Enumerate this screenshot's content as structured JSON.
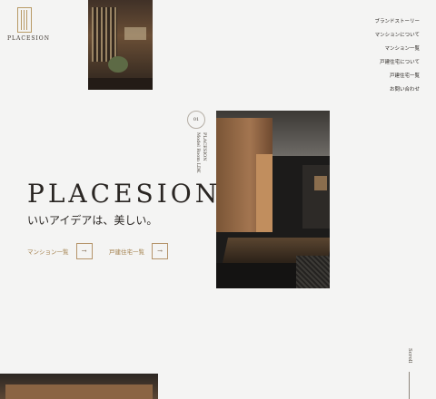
{
  "brand": {
    "logo_text": "PLACESION"
  },
  "nav": {
    "items": [
      "ブランドストーリー",
      "マンションについて",
      "マンション一覧",
      "戸建住宅について",
      "戸建住宅一覧",
      "お問い合わせ"
    ]
  },
  "hero": {
    "title": "PLACESION",
    "subtitle": "いいアイデアは、美しい。",
    "slide_number": "01",
    "caption_line1": "PLACESION",
    "caption_line2": "Model Room LDK"
  },
  "cta": {
    "mansion_label": "マンション一覧",
    "house_label": "戸建住宅一覧",
    "arrow_symbol": "→"
  },
  "scroll": {
    "label": "Scroll"
  },
  "colors": {
    "accent": "#b89a66",
    "text": "#2a2623",
    "background": "#f4f4f3"
  }
}
